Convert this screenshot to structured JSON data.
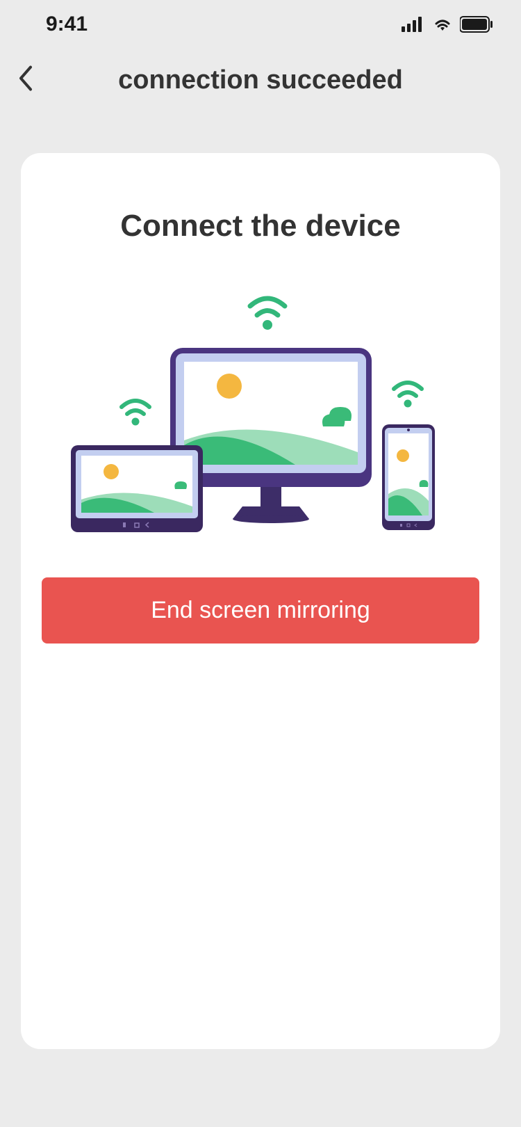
{
  "status_bar": {
    "time": "9:41"
  },
  "header": {
    "title": "connection succeeded"
  },
  "card": {
    "title": "Connect the device",
    "button_label": "End screen mirroring"
  },
  "colors": {
    "background": "#ebebeb",
    "card_bg": "#ffffff",
    "text_primary": "#333333",
    "button_bg": "#e95450",
    "button_text": "#ffffff",
    "wifi_green": "#32b77a",
    "sun_orange": "#f4b740",
    "hill_green": "#3abb78",
    "hill_light": "#9dddb9",
    "device_purple": "#5c4096"
  }
}
